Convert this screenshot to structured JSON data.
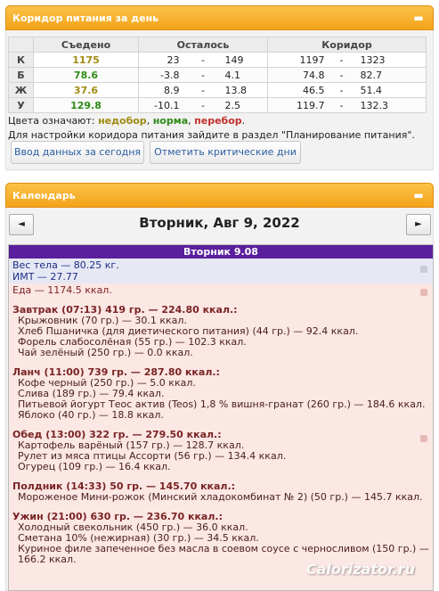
{
  "corridor_panel": {
    "title": "Коридор питания за день",
    "collapse": "▬",
    "headers": {
      "eaten": "Съедено",
      "remaining": "Осталось",
      "corridor": "Коридор"
    },
    "rows": [
      {
        "label": "К",
        "eaten": "1175",
        "rem_from": "23",
        "dash1": "-",
        "rem_to": "149",
        "cor_from": "1197",
        "dash2": "-",
        "cor_to": "1323"
      },
      {
        "label": "Б",
        "eaten": "78.6",
        "rem_from": "-3.8",
        "dash1": "-",
        "rem_to": "4.1",
        "cor_from": "74.8",
        "dash2": "-",
        "cor_to": "82.7"
      },
      {
        "label": "Ж",
        "eaten": "37.6",
        "rem_from": "8.9",
        "dash1": "-",
        "rem_to": "13.8",
        "cor_from": "46.5",
        "dash2": "-",
        "cor_to": "51.4"
      },
      {
        "label": "У",
        "eaten": "129.8",
        "rem_from": "-10.1",
        "dash1": "-",
        "rem_to": "2.5",
        "cor_from": "119.7",
        "dash2": "-",
        "cor_to": "132.3"
      }
    ],
    "legend_prefix": "Цвета означают: ",
    "legend_under": "недобор",
    "legend_norm": "норма",
    "legend_over": "перебор",
    "comma": ", ",
    "dot": ".",
    "hint": "Для настройки коридора питания зайдите в раздел \"Планирование питания\".",
    "btn_today": "Ввод данных за сегодня",
    "btn_critical": "Отметить критические дни",
    "colors": {
      "under": "#a08b14",
      "norm": "#2f8a18",
      "over": "#c0312b"
    }
  },
  "calendar_panel": {
    "title": "Календарь",
    "collapse": "▬",
    "prev": "◄",
    "next": "►",
    "date": "Вторник, Авг 9, 2022",
    "day_title": "Вторник 9.08",
    "weight_line": "Вес тела — 80.25 кг.",
    "bmi_line": "ИМТ — 27.77",
    "food_line": "Еда — 1174.5 ккал.",
    "meals": [
      {
        "title": "Завтрак (07:13) 419 гр. — 224.80 ккал.:",
        "items": [
          "Крыжовник (70 гр.) — 30.1 ккал.",
          "Хлеб Пшаничка (для диетического питания) (44 гр.) — 92.4 ккал.",
          "Форель слабосолёная (55 гр.) — 102.3 ккал.",
          "Чай зелёный (250 гр.) — 0.0 ккал."
        ]
      },
      {
        "title": "Ланч (11:00) 739 гр. — 287.80 ккал.:",
        "items": [
          "Кофе черный (250 гр.) — 5.0 ккал.",
          "Слива (189 гр.) — 79.4 ккал.",
          "Питьевой йогурт Теос актив (Teos) 1,8 % вишня-гранат (260 гр.) — 184.6 ккал.",
          "Яблоко (40 гр.) — 18.8 ккал."
        ]
      },
      {
        "title": "Обед (13:00) 322 гр. — 279.50 ккал.:",
        "items": [
          "Картофель варёный (157 гр.) — 128.7 ккал.",
          "Рулет из мяса птицы Ассорти (56 гр.) — 134.4 ккал.",
          "Огурец (109 гр.) — 16.4 ккал."
        ]
      },
      {
        "title": "Полдник (14:33) 50 гр. — 145.70 ккал.:",
        "items": [
          "Мороженое Мини-рожок (Минский хладокомбинат № 2) (50 гр.) — 145.7 ккал."
        ]
      },
      {
        "title": "Ужин (21:00) 630 гр. — 236.70 ккал.:",
        "items": [
          "Холодный свекольник (450 гр.) — 36.0 ккал.",
          "Сметана 10% (нежирная) (30 гр.) — 34.5 ккал.",
          "Куриное филе запеченное без масла в соевом соусе с черносливом (150 гр.) — 166.2 ккал."
        ]
      }
    ],
    "watermark": "Calorizator.ru"
  }
}
